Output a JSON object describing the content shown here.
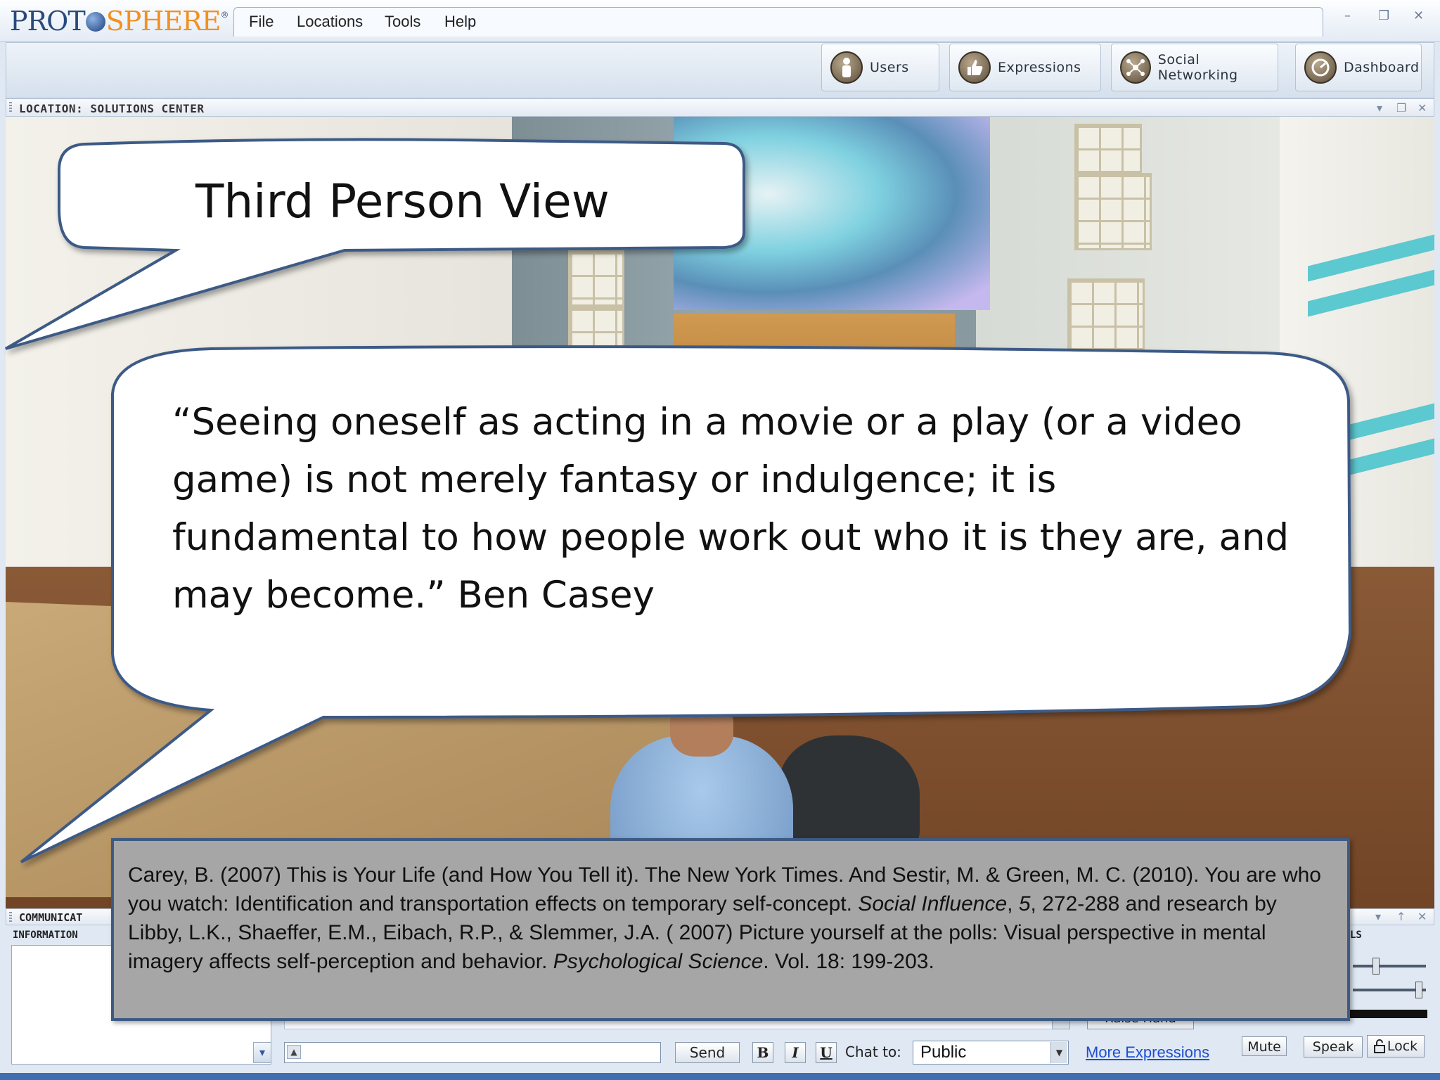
{
  "app": {
    "logo_part1": "PROT",
    "logo_part2": "SPHERE",
    "logo_mark": "®",
    "menu": [
      "File",
      "Locations",
      "Tools",
      "Help"
    ],
    "window_controls": [
      "–",
      "❐",
      "✕"
    ]
  },
  "toolbar": {
    "buttons": [
      {
        "label": "Users",
        "icon": "user-icon"
      },
      {
        "label": "Expressions",
        "icon": "thumbs-up-icon"
      },
      {
        "label": "Social Networking",
        "icon": "network-icon"
      },
      {
        "label": "Dashboard",
        "icon": "dashboard-icon"
      }
    ]
  },
  "location": {
    "label": "LOCATION: SOLUTIONS CENTER",
    "controls": [
      "▾",
      "❐",
      "✕"
    ]
  },
  "overlay": {
    "title": "Third Person View",
    "quote": "“Seeing oneself as acting in a movie or a play (or a video game) is not merely fantasy or indulgence; it is fundamental to how people work out who it is they are, and may become.” Ben Casey",
    "citation_parts": [
      "Carey, B. (2007) This is Your Life (and How You Tell it). The New York Times.  And Sestir, M. & Green, M. C. (2010). You are who you watch: Identification and transportation effects on temporary self-concept. ",
      "Social Influence",
      ", ",
      "5",
      ", 272-288 and research by Libby, L.K., Shaeffer, E.M., Eibach, R.P., & Slemmer, J.A. ( 2007) Picture yourself at the polls: Visual perspective in mental imagery affects self-perception and behavior.  ",
      "Psychological Science",
      ". Vol. 18: 199-203."
    ]
  },
  "communication": {
    "panel_label": "COMMUNICAT",
    "info_label": "INFORMATION",
    "controls_label": "LS",
    "panel_controls": [
      "▾",
      "↑",
      "✕"
    ],
    "raise_hand": "Raise Hand",
    "send": "Send",
    "bold": "B",
    "italic": "I",
    "underline": "U",
    "chat_to_label": "Chat to:",
    "chat_to_value": "Public",
    "more_expressions": "More Expressions",
    "mute": "Mute",
    "speak": "Speak",
    "lock": "Lock",
    "volume_level": 0.3,
    "mic_level": 0.95
  }
}
